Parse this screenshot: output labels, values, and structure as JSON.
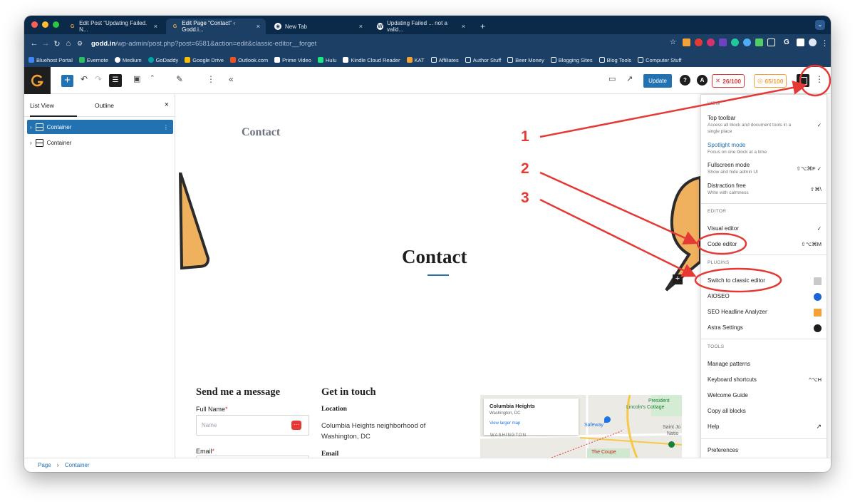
{
  "browser": {
    "tabs": [
      {
        "title": "Edit Post “Updating Failed. N..."
      },
      {
        "title": "Edit Page “Contact” ‹ Godd.i..."
      },
      {
        "title": "New Tab"
      },
      {
        "title": "Updating Failed ... not a valid..."
      }
    ],
    "url_host": "godd.in",
    "url_path": "/wp-admin/post.php?post=6581&action=edit&classic-editor__forget",
    "bookmarks": [
      "Bluehost Portal",
      "Evernote",
      "Medium",
      "GoDaddy",
      "Google Drive",
      "Outlook.com",
      "Prime Video",
      "Hulu",
      "Kindle Cloud Reader",
      "KAT",
      "Affiliates",
      "Author Stuff",
      "Beer Money",
      "Blogging Sites",
      "Blog Tools",
      "Computer Stuff"
    ]
  },
  "toolbar": {
    "update_label": "Update",
    "score1": "26/100",
    "score2": "65/100"
  },
  "list_view": {
    "tab_list": "List View",
    "tab_outline": "Outline",
    "close": "×",
    "items": [
      "Container",
      "Container"
    ]
  },
  "canvas": {
    "header_title": "Contact",
    "hero_title": "Contact",
    "send_heading": "Send me a message",
    "full_name_label": "Full Name",
    "name_placeholder": "Name",
    "email_label": "Email",
    "touch_heading": "Get in touch",
    "location_label": "Location",
    "location_text_1": "Columbia Heights neighborhood of",
    "location_text_2": "Washington, DC",
    "email_heading": "Email",
    "map_title": "Columbia Heights",
    "map_sub": "Washington, DC",
    "map_link": "View larger map",
    "map_labels": [
      "President",
      "Lincoln's Cottage",
      "Safeway",
      "Saint Jo",
      "Natio",
      "WASHINGTON",
      "The Coupe"
    ]
  },
  "menu": {
    "view_group": "VIEW",
    "top_toolbar": "Top toolbar",
    "top_toolbar_desc": "Access all block and document tools in a single place",
    "spotlight": "Spotlight mode",
    "spotlight_desc": "Focus on one block at a time",
    "fullscreen": "Fullscreen mode",
    "fullscreen_desc": "Show and hide admin UI",
    "fullscreen_sc": "⇧⌥⌘F",
    "distraction": "Distraction free",
    "distraction_desc": "Write with calmness",
    "distraction_sc": "⇧⌘\\",
    "editor_group": "EDITOR",
    "visual_editor": "Visual editor",
    "code_editor": "Code editor",
    "code_editor_sc": "⇧⌥⌘M",
    "plugins_group": "PLUGINS",
    "classic": "Switch to classic editor",
    "aioseo": "AIOSEO",
    "seo_headline": "SEO Headline Analyzer",
    "astra": "Astra Settings",
    "tools_group": "TOOLS",
    "manage_patterns": "Manage patterns",
    "keyboard_shortcuts": "Keyboard shortcuts",
    "keyboard_sc": "^⌥H",
    "welcome": "Welcome Guide",
    "copy_blocks": "Copy all blocks",
    "help": "Help",
    "preferences": "Preferences",
    "check": "✓"
  },
  "breadcrumb": {
    "page": "Page",
    "sep": "›",
    "container": "Container"
  },
  "annotations": {
    "labels": [
      "1",
      "2",
      "3"
    ],
    "color": "#e53935"
  }
}
